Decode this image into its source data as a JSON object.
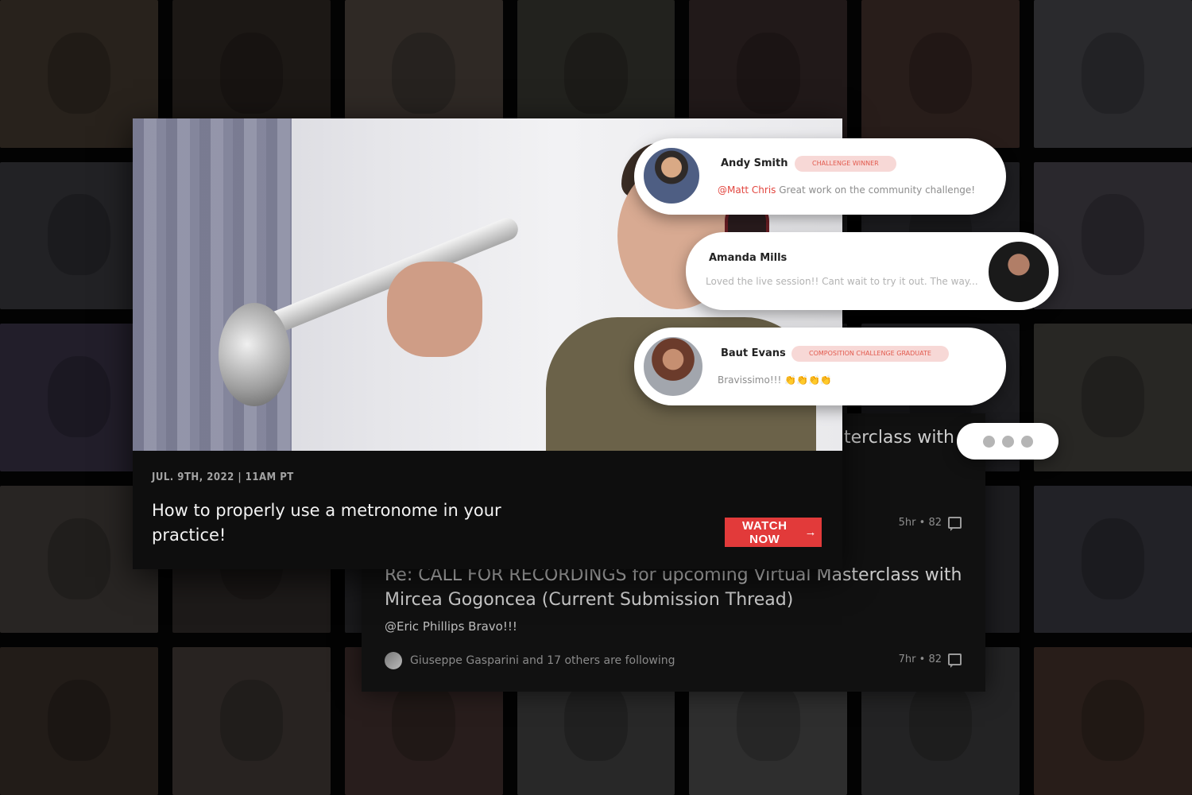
{
  "video": {
    "date": "JUL. 9TH, 2022 | 11AM PT",
    "title": "How to properly use a metronome in your practice!",
    "watch_label": "WATCH NOW",
    "watch_arrow": "→"
  },
  "forum": {
    "partial_title": "terclass with",
    "top_meta": "5hr • 82",
    "thread_title": "Re: CALL FOR RECORDINGS for upcoming Virtual Masterclass with Mircea Gogoncea (Current Submission Thread)",
    "reply_text": "@Eric Phillips Bravo!!!",
    "following_text": "Giuseppe Gasparini and 17 others are following",
    "bottom_meta": "7hr • 82"
  },
  "comments": [
    {
      "name": "Andy Smith",
      "badge": "CHALLENGE WINNER",
      "mention": "@Matt Chris",
      "text": " Great work on the community challenge!"
    },
    {
      "name": "Amanda Mills",
      "badge": "",
      "mention": "",
      "text": "Loved the live session!! Cant wait to try it out. The way..."
    },
    {
      "name": "Baut Evans",
      "badge": "COMPOSITION CHALLENGE GRADUATE",
      "mention": "",
      "text": "Bravissimo!!! 👏👏👏👏"
    }
  ],
  "colors": {
    "accent": "#e23a3a",
    "badge_bg": "#f7d8d6",
    "badge_text": "#e25a4e",
    "background": "#0b0b0b"
  }
}
